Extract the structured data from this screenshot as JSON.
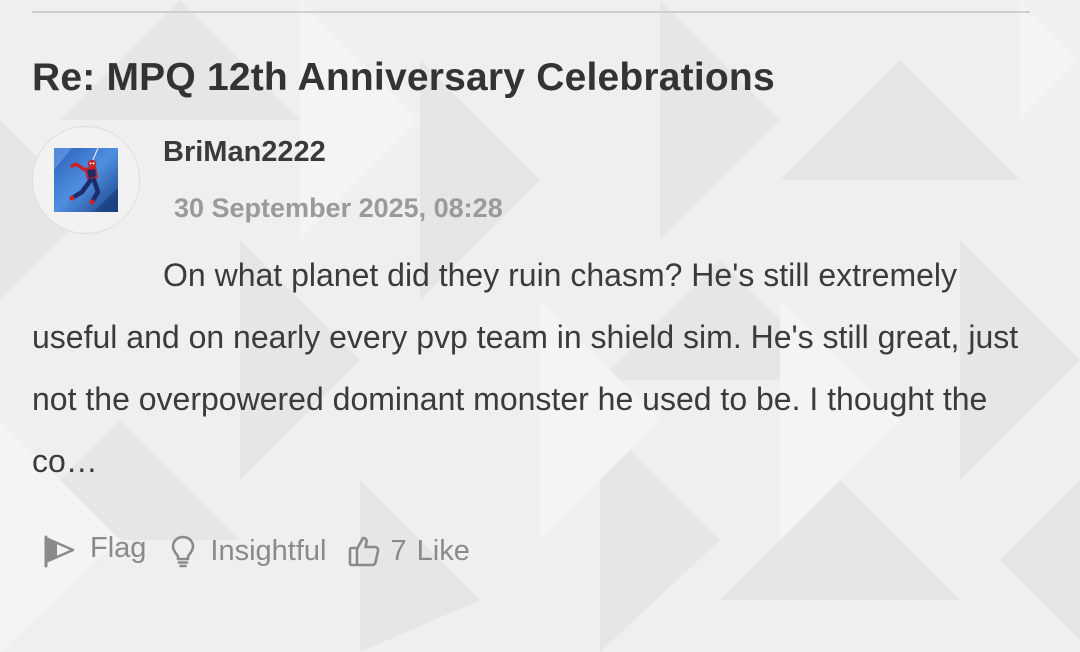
{
  "post": {
    "title": "Re: MPQ 12th Anniversary Celebrations",
    "author": "BriMan2222",
    "timestamp": "30 September 2025, 08:28",
    "body": "On what planet did they ruin chasm? He's still extremely useful and on nearly every pvp team in shield sim. He's still great, just not the overpowered dominant monster he used to be. I thought the co…"
  },
  "actions": {
    "flag_label": "Flag",
    "insightful_label": "Insightful",
    "like_count": "7",
    "like_label": "Like"
  },
  "icons": {
    "flag": "flag-icon",
    "insightful": "lightbulb-icon",
    "like": "thumbs-up-icon",
    "avatar": "spider-man-avatar"
  },
  "colors": {
    "title": "#333333",
    "body_text": "#3b3b3b",
    "timestamp": "#9a9a9a",
    "action": "#8a8a8a",
    "background": "#efefef"
  }
}
